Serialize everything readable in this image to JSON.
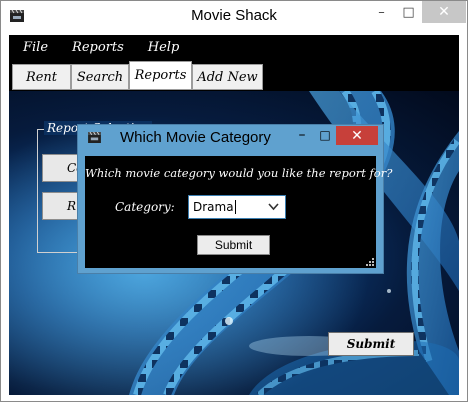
{
  "window": {
    "title": "Movie Shack",
    "controls": {
      "minimize": "–",
      "maximize": "□",
      "close": "✕"
    }
  },
  "menu": {
    "items": [
      "File",
      "Reports",
      "Help"
    ]
  },
  "tabs": [
    {
      "label": "Rent",
      "active": false
    },
    {
      "label": "Search",
      "active": false
    },
    {
      "label": "Reports",
      "active": true
    },
    {
      "label": "Add New",
      "active": false
    }
  ],
  "report_panel": {
    "group_legend": "Report Selection",
    "button1_label": "Co",
    "button2_label": "R",
    "submit_label": "Submit"
  },
  "dialog": {
    "title": "Which Movie Category",
    "question": "Which movie category would you like the report for?",
    "category_label": "Category:",
    "category_value": "Drama",
    "submit_label": "Submit",
    "controls": {
      "minimize": "–",
      "maximize": "□",
      "close": "✕"
    }
  },
  "icons": {
    "app": "film-clapper-icon",
    "dialog": "film-clapper-icon",
    "dropdown": "chevron-down-icon",
    "resize": "resize-grip-icon"
  },
  "colors": {
    "dialog_frame": "#5fa1cf",
    "dialog_close": "#c7403a",
    "menubar": "#000000",
    "background_glow": "#1a6cb5"
  }
}
